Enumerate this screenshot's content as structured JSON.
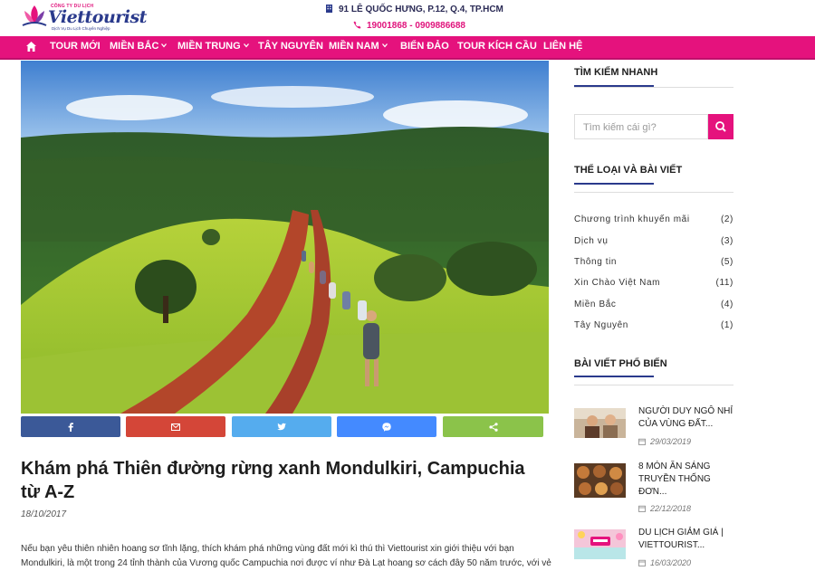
{
  "header": {
    "logo_small": "CÔNG TY DU LỊCH",
    "logo_brand": "Viettourist",
    "logo_tagline": "Dịch Vụ Du Lịch Chuyên Nghiệp",
    "address": "91 LÊ QUỐC HƯNG, P.12, Q.4, TP.HCM",
    "phone": "19001868 - 0909886688"
  },
  "nav": {
    "items": [
      {
        "label": "TOUR MỚI",
        "dropdown": false
      },
      {
        "label": "MIỀN BẮC",
        "dropdown": true
      },
      {
        "label": "MIỀN TRUNG",
        "dropdown": true
      },
      {
        "label": "TÂY NGUYÊN",
        "dropdown": false
      },
      {
        "label": "MIỀN NAM",
        "dropdown": true
      },
      {
        "label": "BIỂN ĐẢO",
        "dropdown": false
      },
      {
        "label": "TOUR KÍCH CẦU",
        "dropdown": false
      },
      {
        "label": "LIÊN HỆ",
        "dropdown": false
      }
    ]
  },
  "share": [
    {
      "icon": "facebook-icon",
      "color": "#3b5998"
    },
    {
      "icon": "email-icon",
      "color": "#d44638"
    },
    {
      "icon": "twitter-icon",
      "color": "#55acee"
    },
    {
      "icon": "messenger-icon",
      "color": "#448aff"
    },
    {
      "icon": "share-icon",
      "color": "#8bc34a"
    }
  ],
  "article": {
    "title": "Khám phá Thiên đường rừng xanh Mondulkiri, Campuchia từ A-Z",
    "date": "18/10/2017",
    "intro": "Nếu bạn yêu thiên nhiên hoang sơ tĩnh lặng, thích khám phá những vùng đất mới kì thú thì Viettourist xin giới thiệu với bạn Mondulkiri, là một trong 24 tỉnh thành của Vương quốc Campuchia nơi được ví như Đà Lạt hoang sơ cách đây 50 năm trước, với vẻ"
  },
  "sidebar": {
    "search_heading": "TÌM KIẾM NHANH",
    "search_placeholder": "Tìm kiếm cái gì?",
    "categories_heading": "THỂ LOẠI VÀ BÀI VIẾT",
    "categories": [
      {
        "name": "Chương trình khuyến mãi",
        "count": "(2)"
      },
      {
        "name": "Dịch vụ",
        "count": "(3)"
      },
      {
        "name": "Thông tin",
        "count": "(5)"
      },
      {
        "name": "Xin Chào Việt Nam",
        "count": "(11)"
      },
      {
        "name": "Miền Bắc",
        "count": "(4)"
      },
      {
        "name": "Tây Nguyên",
        "count": "(1)"
      }
    ],
    "popular_heading": "BÀI VIẾT PHỔ BIẾN",
    "popular": [
      {
        "title": "NGƯỜI DUY NGÔ NHỈ CỦA VÙNG ĐẤT...",
        "date": "29/03/2019"
      },
      {
        "title": "8 MÓN ĂN SÁNG TRUYỀN THỐNG ĐƠN...",
        "date": "22/12/2018"
      },
      {
        "title": "DU LỊCH GIẢM GIÁ | VIETTOURIST...",
        "date": "16/03/2020"
      }
    ]
  }
}
